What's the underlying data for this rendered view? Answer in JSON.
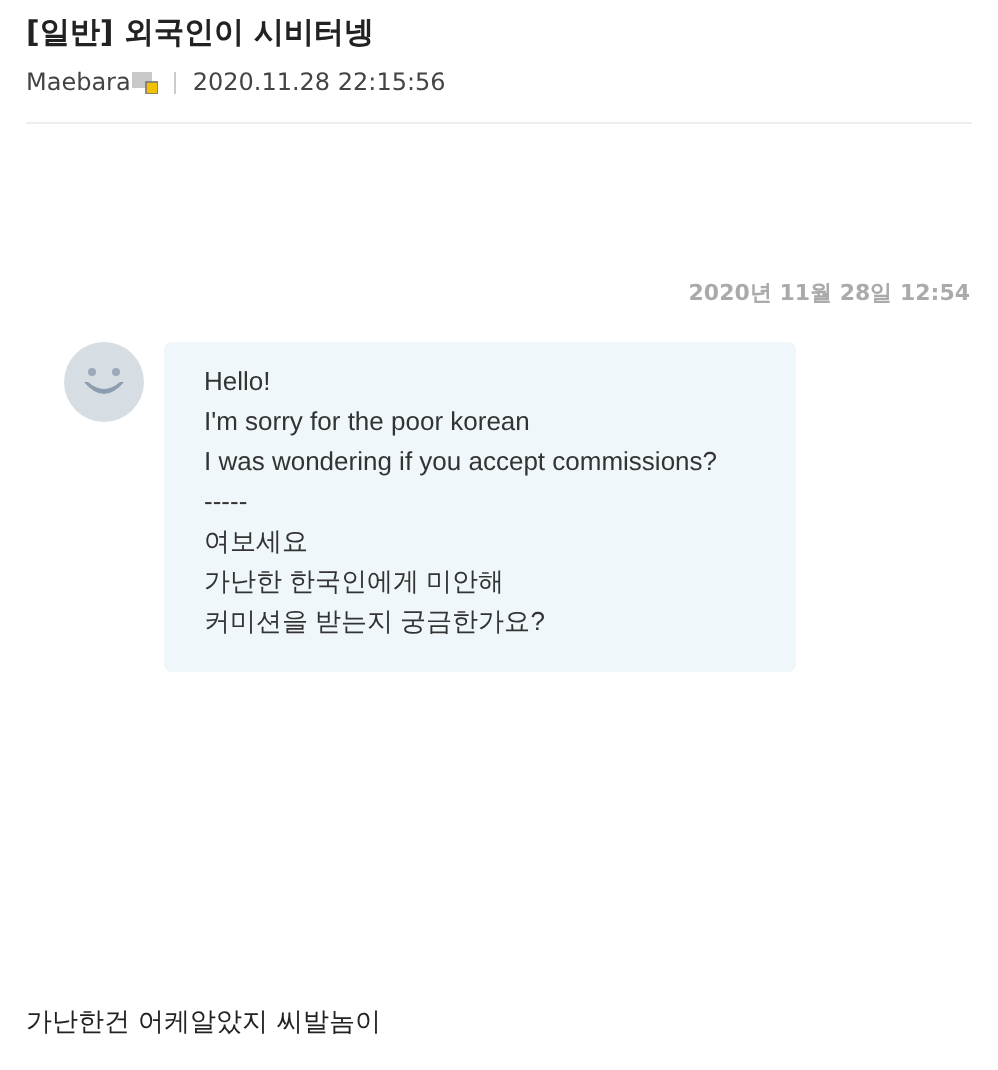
{
  "post": {
    "title": "[일반] 외국인이 시비터넹",
    "author": "Maebara",
    "datetime": "2020.11.28 22:15:56"
  },
  "chat": {
    "timestamp": "2020년 11월 28일 12:54",
    "message_lines": [
      "Hello!",
      "I'm sorry for the poor korean",
      "I was wondering if you accept commissions?",
      "-----",
      "여보세요",
      "가난한 한국인에게 미안해",
      "커미션을 받는지 궁금한가요?"
    ]
  },
  "comment": "가난한건 어케알았지 씨발놈이"
}
